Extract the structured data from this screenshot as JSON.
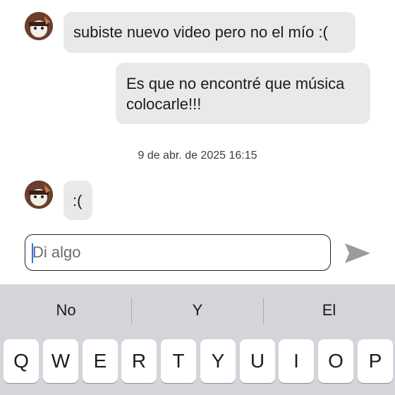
{
  "messages": [
    {
      "direction": "incoming",
      "text": "subiste nuevo video pero no el mío :("
    },
    {
      "direction": "outgoing",
      "text": "Es que no encontré que música colocarle!!!"
    },
    {
      "direction": "incoming",
      "text": ":("
    }
  ],
  "timestamp": "9 de abr. de 2025 16:15",
  "composer": {
    "placeholder": "Di algo",
    "send_icon": "send-icon"
  },
  "keyboard": {
    "suggestions": [
      "No",
      "Y",
      "El"
    ],
    "row1": [
      "Q",
      "W",
      "E",
      "R",
      "T",
      "Y",
      "U",
      "I",
      "O",
      "P"
    ]
  },
  "colors": {
    "bubble": "#e9e9ec",
    "keyboard_bg": "#d3d5da",
    "caret": "#2b6ff0",
    "send_icon": "#9a9a9f"
  }
}
